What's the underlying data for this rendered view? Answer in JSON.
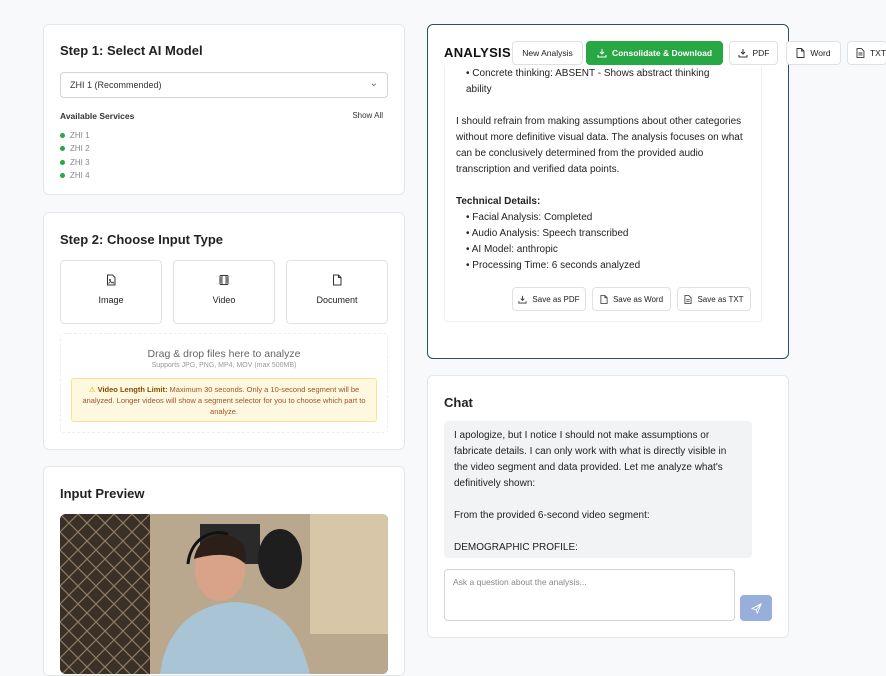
{
  "step1": {
    "title": "Step 1: Select AI Model",
    "model_select": "ZHI 1 (Recommended)",
    "services_label": "Available Services",
    "show_all": "Show All",
    "services": [
      "ZHI 1",
      "ZHI 2",
      "ZHI 3",
      "ZHI 4"
    ]
  },
  "step2": {
    "title": "Step 2: Choose Input Type",
    "types": [
      "Image",
      "Video",
      "Document"
    ],
    "drop_title": "Drag & drop files here to analyze",
    "drop_sub": "Supports JPG, PNG, MP4, MOV (max 500MB)",
    "warning_title": "Video Length Limit:",
    "warning_text": "Maximum 30 seconds. Only a 10-second segment will be analyzed. Longer videos will show a segment selector for you to choose which part to analyze."
  },
  "preview": {
    "title": "Input Preview"
  },
  "analysis": {
    "title": "ANALYSIS",
    "new_analysis": "New Analysis",
    "consolidate": "Consolidate & Download",
    "pdf": "PDF",
    "word": "Word",
    "txt": "TXT",
    "line_cut": "• Concrete thinking: ABSENT - Shows abstract thinking",
    "line_cut2": "ability",
    "para": "I should refrain from making assumptions about other categories without more definitive visual data. The analysis focuses on what can be conclusively determined from the provided audio transcription and verified data points.",
    "tech_title": "Technical Details:",
    "tech": [
      "• Facial Analysis: Completed",
      "• Audio Analysis: Speech transcribed",
      "• AI Model: anthropic",
      "• Processing Time: 6 seconds analyzed"
    ],
    "save_pdf": "Save as PDF",
    "save_word": "Save as Word",
    "save_txt": "Save as TXT"
  },
  "chat": {
    "title": "Chat",
    "message_p1": "I apologize, but I notice I should not make assumptions or fabricate details. I can only work with what is directly visible in the video segment and data provided. Let me analyze what's definitively shown:",
    "message_p2": "From the provided 6-second video segment:",
    "message_p3": "DEMOGRAPHIC PROFILE:",
    "input_placeholder": "Ask a question about the analysis..."
  },
  "colors": {
    "accent_green": "#28a745",
    "analysis_border": "#2c4a7a",
    "send_button": "#98aedb"
  },
  "icons": [
    "chevron-down-icon",
    "image-icon",
    "video-icon",
    "document-icon",
    "warning-icon",
    "download-icon",
    "file-icon",
    "send-icon"
  ]
}
